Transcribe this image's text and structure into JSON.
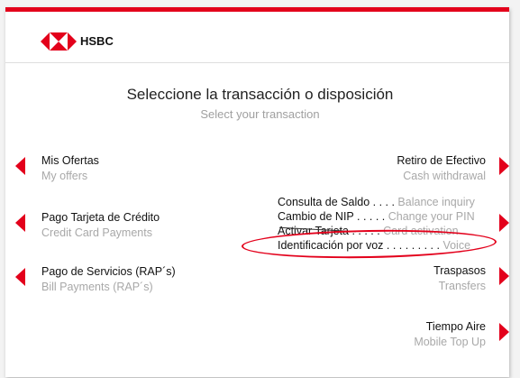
{
  "brand": {
    "name": "HSBC",
    "color": "#e3001b"
  },
  "title": {
    "es": "Seleccione la transacción o disposición",
    "en": "Select your transaction"
  },
  "left_options": [
    {
      "es": "Mis Ofertas",
      "en": "My offers"
    },
    {
      "es": "Pago Tarjeta de Crédito",
      "en": "Credit Card Payments"
    },
    {
      "es": "Pago de Servicios (RAP´s)",
      "en": "Bill Payments (RAP´s)"
    }
  ],
  "right_options": {
    "retiro": {
      "es": "Retiro de Efectivo",
      "en": "Cash withdrawal"
    },
    "group": [
      {
        "es": "Consulta de Saldo",
        "dots": " . . . . ",
        "en": "Balance inquiry"
      },
      {
        "es": "Cambio de NIP",
        "dots": " . . . . . ",
        "en": "Change your PIN"
      },
      {
        "es": "Activar Tarjeta",
        "dots": " . . . . . ",
        "en": "Card activation"
      },
      {
        "es": "Identificación por voz",
        "dots": " . . . . . . . . . ",
        "en": "Voice"
      }
    ],
    "traspasos": {
      "es": "Traspasos",
      "en": "Transfers"
    },
    "tiempo_aire": {
      "es": "Tiempo Aire",
      "en": "Mobile Top Up"
    }
  }
}
